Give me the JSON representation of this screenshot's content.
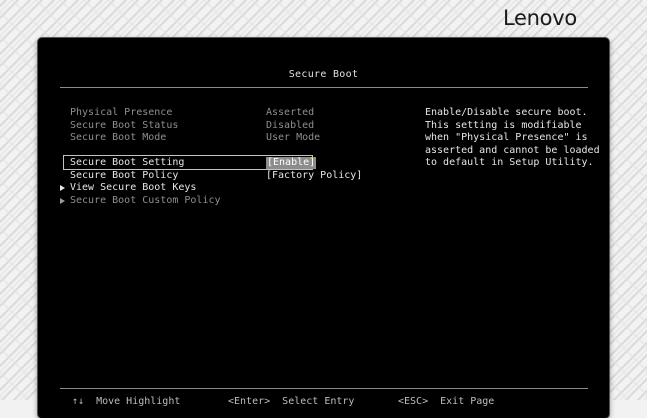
{
  "brand": {
    "logo_text": "Lenovo"
  },
  "page": {
    "title": "Secure Boot"
  },
  "settings": [
    {
      "label": "Physical Presence",
      "value": "Asserted"
    },
    {
      "label": "Secure Boot Status",
      "value": "Disabled"
    },
    {
      "label": "Secure Boot Mode",
      "value": "User Mode"
    }
  ],
  "options": {
    "secure_boot_setting": {
      "label": "Secure Boot Setting",
      "value": "[Enable]"
    },
    "secure_boot_policy": {
      "label": "Secure Boot Policy",
      "value": "[Factory Policy]"
    }
  },
  "submenus": [
    {
      "label": "View Secure Boot Keys"
    },
    {
      "label": "Secure Boot Custom Policy"
    }
  ],
  "help_text": "Enable/Disable secure boot.\nThis setting is modifiable\nwhen \"Physical Presence\" is\nasserted and cannot be loaded\nto default in Setup Utility.",
  "footer": {
    "col1": "↑↓  Move Highlight",
    "col2": "<Enter>  Select Entry",
    "col3": "<ESC>  Exit Page"
  },
  "colors": {
    "selection_border": "#e6d21a",
    "background": "#000000",
    "highlight_value": "#8c8c8c"
  }
}
